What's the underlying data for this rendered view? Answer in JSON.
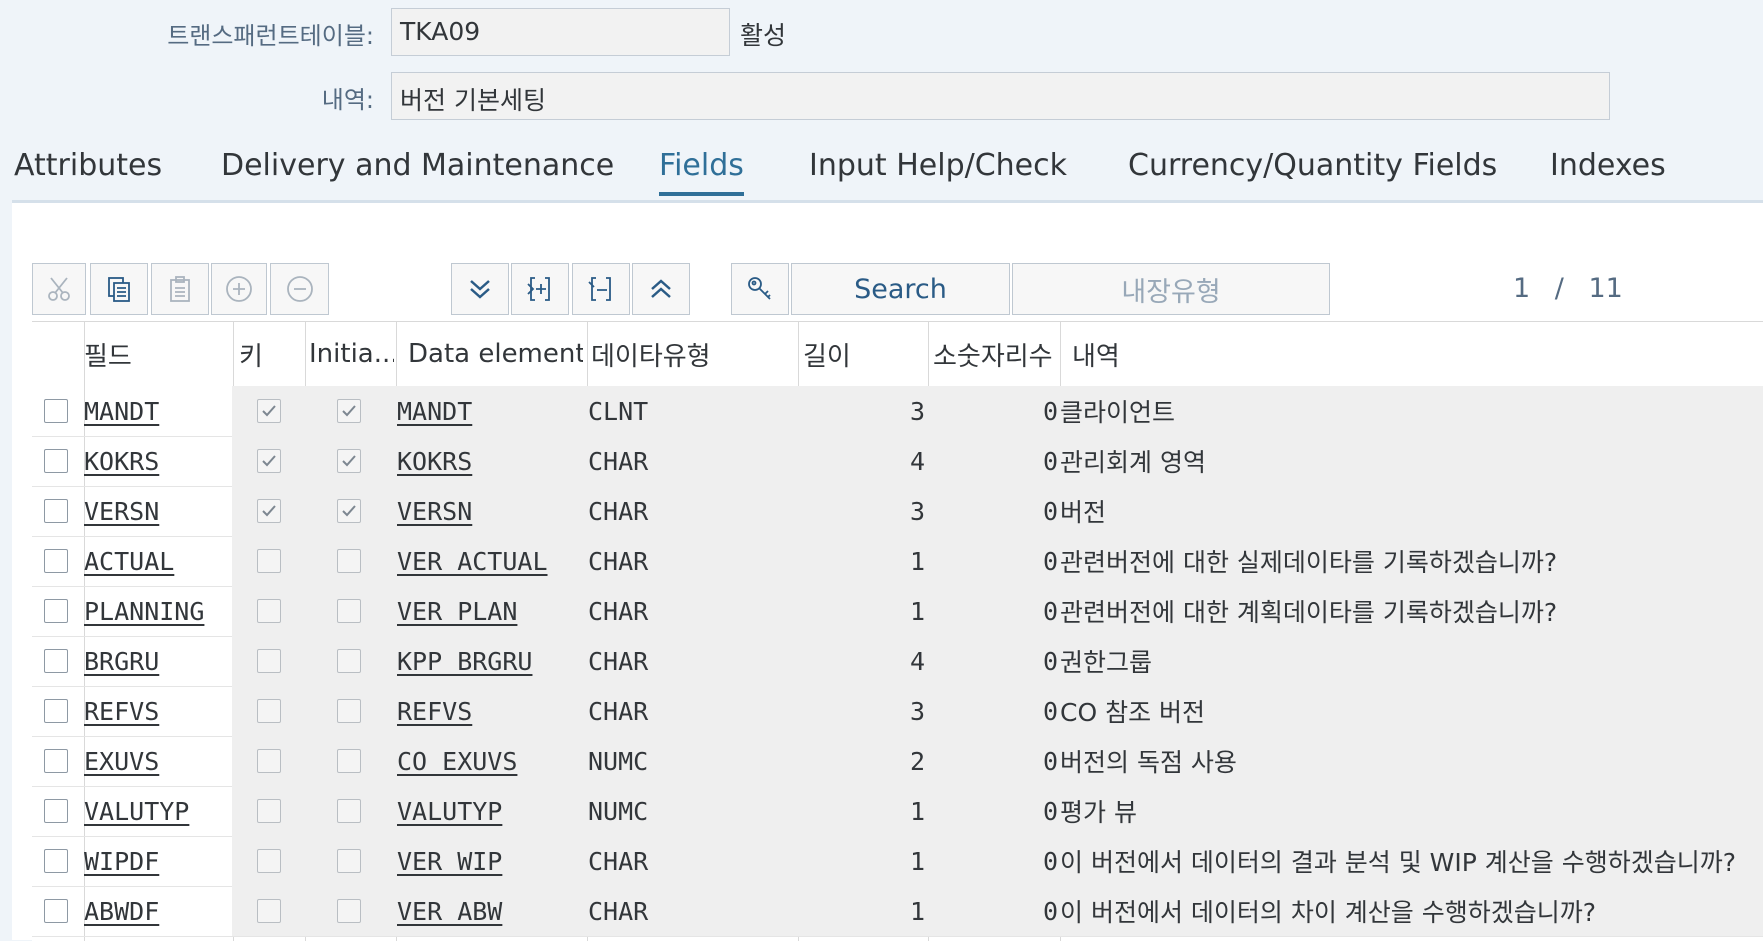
{
  "header": {
    "table_label": "트랜스패런트테이블:",
    "table_value": "TKA09",
    "status": "활성",
    "desc_label": "내역:",
    "desc_value": "버전 기본세팅"
  },
  "tabs": [
    {
      "label": "Attributes"
    },
    {
      "label": "Delivery and Maintenance"
    },
    {
      "label": "Fields"
    },
    {
      "label": "Input Help/Check"
    },
    {
      "label": "Currency/Quantity Fields"
    },
    {
      "label": "Indexes"
    }
  ],
  "toolbar": {
    "search_label": "Search",
    "builtin_type_label": "내장유형",
    "page_current": "1",
    "page_sep": "/",
    "page_total": "11"
  },
  "columns": {
    "field": "필드",
    "key": "키",
    "initial": "Initia...",
    "data_element": "Data element",
    "data_type": "데이타유형",
    "length": "길이",
    "decimals": "소숫자리수",
    "description": "내역"
  },
  "rows": [
    {
      "field": "MANDT",
      "key": true,
      "initial": true,
      "data_element": "MANDT",
      "type": "CLNT",
      "length": "3",
      "decimals": "0",
      "desc": "클라이언트"
    },
    {
      "field": "KOKRS",
      "key": true,
      "initial": true,
      "data_element": "KOKRS",
      "type": "CHAR",
      "length": "4",
      "decimals": "0",
      "desc": "관리회계 영역"
    },
    {
      "field": "VERSN",
      "key": true,
      "initial": true,
      "data_element": "VERSN",
      "type": "CHAR",
      "length": "3",
      "decimals": "0",
      "desc": "버전"
    },
    {
      "field": "ACTUAL",
      "key": false,
      "initial": false,
      "data_element": "VER_ACTUAL",
      "type": "CHAR",
      "length": "1",
      "decimals": "0",
      "desc": "관련버전에 대한 실제데이타를 기록하겠습니까?"
    },
    {
      "field": "PLANNING",
      "key": false,
      "initial": false,
      "data_element": "VER_PLAN",
      "type": "CHAR",
      "length": "1",
      "decimals": "0",
      "desc": "관련버전에 대한 계획데이타를 기록하겠습니까?"
    },
    {
      "field": "BRGRU",
      "key": false,
      "initial": false,
      "data_element": "KPP_BRGRU",
      "type": "CHAR",
      "length": "4",
      "decimals": "0",
      "desc": "권한그룹"
    },
    {
      "field": "REFVS",
      "key": false,
      "initial": false,
      "data_element": "REFVS",
      "type": "CHAR",
      "length": "3",
      "decimals": "0",
      "desc": "CO 참조 버전"
    },
    {
      "field": "EXUVS",
      "key": false,
      "initial": false,
      "data_element": "CO_EXUVS",
      "type": "NUMC",
      "length": "2",
      "decimals": "0",
      "desc": "버전의 독점 사용"
    },
    {
      "field": "VALUTYP",
      "key": false,
      "initial": false,
      "data_element": "VALUTYP",
      "type": "NUMC",
      "length": "1",
      "decimals": "0",
      "desc": "평가 뷰"
    },
    {
      "field": "WIPDF",
      "key": false,
      "initial": false,
      "data_element": "VER_WIP",
      "type": "CHAR",
      "length": "1",
      "decimals": "0",
      "desc": "이 버전에서 데이터의 결과 분석 및 WIP 계산을 수행하겠습니까?"
    },
    {
      "field": "ABWDF",
      "key": false,
      "initial": false,
      "data_element": "VER_ABW",
      "type": "CHAR",
      "length": "1",
      "decimals": "0",
      "desc": "이 버전에서 데이터의 차이 계산을 수행하겠습니까?"
    }
  ]
}
